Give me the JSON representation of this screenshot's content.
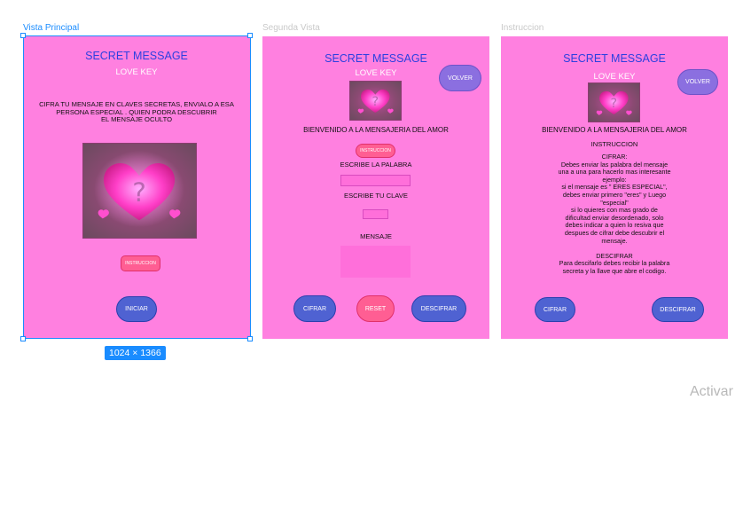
{
  "frames": {
    "principal": {
      "label": "Vista Principal",
      "title": "SECRET MESSAGE",
      "subtitle": "LOVE KEY",
      "description": [
        "CIFRA TU MENSAJE  EN CLAVES SECRETAS, ENVIALO A ESA",
        "PERSONA  ESPECIAL . QUIEN  PODRA DESCUBRIR",
        "EL MENSAJE OCULTO"
      ],
      "instruccion_button": "INSTRUCCION",
      "iniciar_button": "INICIAR",
      "size_badge": "1024 × 1366"
    },
    "segunda": {
      "label": "Segunda Vista",
      "title": "SECRET MESSAGE",
      "subtitle": "LOVE KEY",
      "volver_button": "VOLVER",
      "welcome": "BIENVENIDO A LA MENSAJERIA DEL AMOR",
      "instruccion_button": "INSTRUCCION",
      "word_label": "ESCRIBE LA PALABRA",
      "key_label": "ESCRIBE TU CLAVE",
      "message_label": "MENSAJE",
      "cifrar_button": "CIFRAR",
      "reset_button": "RESET",
      "descifrar_button": "DESCIFRAR"
    },
    "instruccion": {
      "label": "Instruccion",
      "title": "SECRET MESSAGE",
      "subtitle": "LOVE KEY",
      "volver_button": "VOLVER",
      "welcome": "BIENVENIDO A LA MENSAJERIA DEL AMOR",
      "heading": "INSTRUCCION",
      "body": [
        "CIFRAR:",
        "Debes enviar las palabra del mensaje",
        "una a una para hacerlo mas interesante",
        "ejemplo:",
        "si el mensaje es \" ERES ESPECIAL\",",
        "debes enviar primero \"eres\" y Luego",
        "\"especial\"",
        "si lo quieres con mas grado de",
        "dificultad enviar desordenado, solo",
        "debes indicar a quien lo resiva que",
        "despues de cifrar debe descubrir el",
        "mensaje.",
        "",
        "DESCIFRAR",
        "Para descifarlo debes recibir la palabra",
        "secreta y la llave que abre el codigo."
      ],
      "cifrar_button": "CIFRAR",
      "descifrar_button": "DESCIFRAR"
    }
  },
  "heart_glyph": "?",
  "watermark": "Activar",
  "colors": {
    "frame_bg": "#ff80e0",
    "title": "#2c40e0",
    "selection": "#1a8cff",
    "button_blue": "#4f62d2",
    "button_pink": "#ff5e93",
    "button_purple": "#8b6fe0"
  }
}
